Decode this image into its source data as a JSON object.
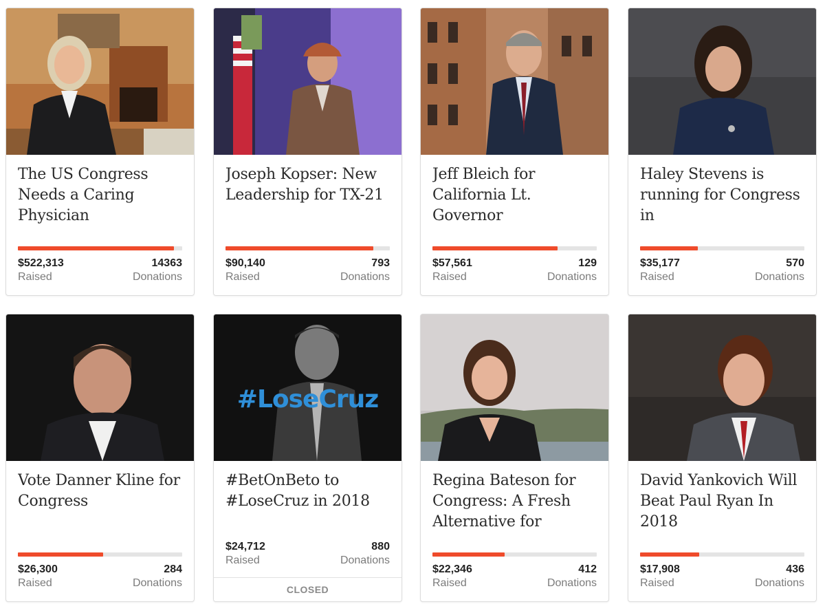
{
  "campaigns": [
    {
      "title": "The US Congress Needs a Caring Physician",
      "amount": "$522,313",
      "raised_label": "Raised",
      "donations": "14363",
      "donations_label": "Donations",
      "progress": 0.95
    },
    {
      "title": "Joseph Kopser: New Leadership for TX-21",
      "amount": "$90,140",
      "raised_label": "Raised",
      "donations": "793",
      "donations_label": "Donations",
      "progress": 0.9
    },
    {
      "title": "Jeff Bleich for California Lt. Governor",
      "amount": "$57,561",
      "raised_label": "Raised",
      "donations": "129",
      "donations_label": "Donations",
      "progress": 0.76
    },
    {
      "title": "Haley Stevens is running for Congress in",
      "amount": "$35,177",
      "raised_label": "Raised",
      "donations": "570",
      "donations_label": "Donations",
      "progress": 0.35
    },
    {
      "title": "Vote Danner Kline for Congress",
      "amount": "$26,300",
      "raised_label": "Raised",
      "donations": "284",
      "donations_label": "Donations",
      "progress": 0.52
    },
    {
      "title": "#BetOnBeto to #LoseCruz in 2018",
      "amount": "$24,712",
      "raised_label": "Raised",
      "donations": "880",
      "donations_label": "Donations",
      "status": "CLOSED",
      "image_text": "#LoseCruz"
    },
    {
      "title": "Regina Bateson for Congress: A Fresh Alternative for",
      "amount": "$22,346",
      "raised_label": "Raised",
      "donations": "412",
      "donations_label": "Donations",
      "progress": 0.44
    },
    {
      "title": "David Yankovich Will Beat Paul Ryan In 2018",
      "amount": "$17,908",
      "raised_label": "Raised",
      "donations": "436",
      "donations_label": "Donations",
      "progress": 0.36
    }
  ],
  "colors": {
    "progress_fill": "#ef4b2b",
    "progress_track": "#e4e4e4",
    "image_text": "#2f8fd8"
  }
}
